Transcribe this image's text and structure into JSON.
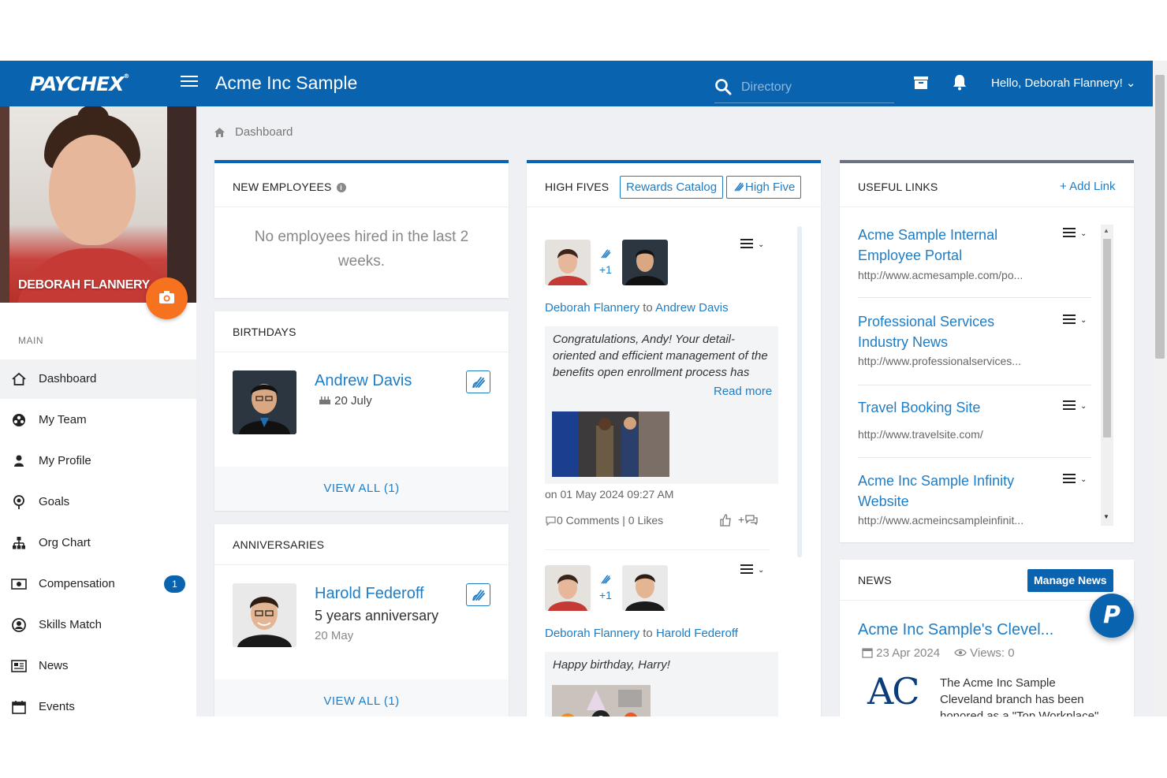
{
  "header": {
    "logo": "PAYCHEX",
    "company": "Acme Inc Sample",
    "search_placeholder": "Directory",
    "user_greeting": "Hello, Deborah Flannery! ⌄"
  },
  "profile": {
    "name": "DEBORAH FLANNERY"
  },
  "sidebar": {
    "section": "MAIN",
    "items": [
      {
        "label": "Dashboard",
        "icon": "home-icon"
      },
      {
        "label": "My Team",
        "icon": "team-icon"
      },
      {
        "label": "My Profile",
        "icon": "user-icon"
      },
      {
        "label": "Goals",
        "icon": "target-icon"
      },
      {
        "label": "Org Chart",
        "icon": "org-chart-icon"
      },
      {
        "label": "Compensation",
        "icon": "money-icon",
        "badge": "1"
      },
      {
        "label": "Skills Match",
        "icon": "skills-icon"
      },
      {
        "label": "News",
        "icon": "newspaper-icon"
      },
      {
        "label": "Events",
        "icon": "calendar-icon"
      }
    ]
  },
  "breadcrumb": "Dashboard",
  "new_employees": {
    "title": "NEW EMPLOYEES",
    "empty_line1": "No employees hired in the last 2",
    "empty_line2": "weeks."
  },
  "birthdays": {
    "title": "BIRTHDAYS",
    "name": "Andrew Davis",
    "date": "20 July",
    "view_all": "VIEW ALL (1)"
  },
  "anniversaries": {
    "title": "ANNIVERSARIES",
    "name": "Harold Federoff",
    "text": "5 years anniversary",
    "date": "20 May",
    "view_all": "VIEW ALL (1)"
  },
  "high_fives": {
    "title": "HIGH FIVES",
    "rewards_btn": "Rewards Catalog",
    "high_five_btn": "High Five",
    "posts": [
      {
        "plus": "+1",
        "from": "Deborah Flannery",
        "to_word": "to",
        "to": "Andrew Davis",
        "message_l1": "Congratulations, Andy! Your detail-",
        "message_l2": "oriented and efficient management of the",
        "message_l3": "benefits open enrollment process has",
        "read_more": "Read more",
        "timestamp": "on 01 May 2024 09:27 AM",
        "stats": "0 Comments | 0 Likes",
        "comment_add": "+"
      },
      {
        "plus": "+1",
        "from": "Deborah Flannery",
        "to_word": "to",
        "to": "Harold Federoff",
        "message_l1": "Happy birthday, Harry!"
      }
    ]
  },
  "useful_links": {
    "title": "USEFUL LINKS",
    "add_link": "+ Add Link",
    "links": [
      {
        "title_l1": "Acme Sample Internal",
        "title_l2": "Employee Portal",
        "url": "http://www.acmesample.com/po..."
      },
      {
        "title_l1": "Professional Services",
        "title_l2": "Industry News",
        "url": "http://www.professionalservices..."
      },
      {
        "title_l1": "Travel Booking Site",
        "title_l2": "",
        "url": "http://www.travelsite.com/"
      },
      {
        "title_l1": "Acme Inc Sample Infinity",
        "title_l2": "Website",
        "url": "http://www.acmeincsampleinfinit..."
      }
    ]
  },
  "news": {
    "title": "NEWS",
    "manage_btn": "Manage News",
    "headline": "Acme Inc Sample's Clevel...",
    "date": "23 Apr 2024",
    "views": "Views: 0",
    "logo_text": "AC",
    "body_l1": "The Acme Inc Sample",
    "body_l2": "Cleveland branch has been",
    "body_l3": "honored as a \"Top Workplace\""
  },
  "chat_fab": "P",
  "colors": {
    "brand": "#0a63ae",
    "link": "#1f7dc5",
    "accent": "#f7721f"
  }
}
